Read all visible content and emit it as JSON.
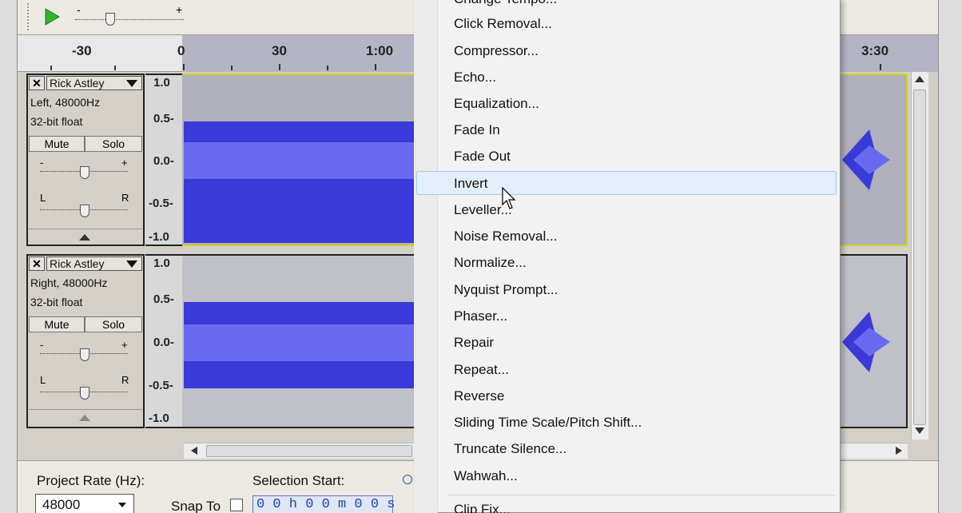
{
  "toolbar": {
    "play_icon": "play-icon",
    "gain_minus": "-",
    "gain_plus": "+"
  },
  "ruler": {
    "labels": [
      "-30",
      "0",
      "30",
      "1:00",
      "3:30"
    ]
  },
  "tracks": [
    {
      "name": "Rick Astley",
      "info_line1": "Left, 48000Hz",
      "info_line2": "32-bit float",
      "mute": "Mute",
      "solo": "Solo",
      "gain_minus": "-",
      "gain_plus": "+",
      "pan_left": "L",
      "pan_right": "R",
      "scale": [
        "1.0",
        "0.5-",
        "0.0-",
        "-0.5-",
        "-1.0"
      ]
    },
    {
      "name": "Rick Astley",
      "info_line1": "Right, 48000Hz",
      "info_line2": "32-bit float",
      "mute": "Mute",
      "solo": "Solo",
      "gain_minus": "-",
      "gain_plus": "+",
      "pan_left": "L",
      "pan_right": "R",
      "scale": [
        "1.0",
        "0.5-",
        "0.0-",
        "-0.5-",
        "-1.0"
      ]
    }
  ],
  "effect_menu": {
    "items": [
      "Change Tempo...",
      "Click Removal...",
      "Compressor...",
      "Echo...",
      "Equalization...",
      "Fade In",
      "Fade Out",
      "Invert",
      "Leveller...",
      "Noise Removal...",
      "Normalize...",
      "Nyquist Prompt...",
      "Phaser...",
      "Repair",
      "Repeat...",
      "Reverse",
      "Sliding Time Scale/Pitch Shift...",
      "Truncate Silence...",
      "Wahwah...",
      "Clip Fix..."
    ],
    "highlighted": "Invert"
  },
  "bottom": {
    "project_rate_label": "Project Rate (Hz):",
    "project_rate_value": "48000",
    "snap_to_label": "Snap To",
    "selection_start_label": "Selection Start:",
    "selection_start_value": "0 0 h 0 0 m 0 0 s"
  },
  "colors": {
    "wave_dark": "#3a3ad8",
    "wave_light": "#6a6af0",
    "selection": "#b0b0bc",
    "menu_highlight": "#e3eefb"
  }
}
